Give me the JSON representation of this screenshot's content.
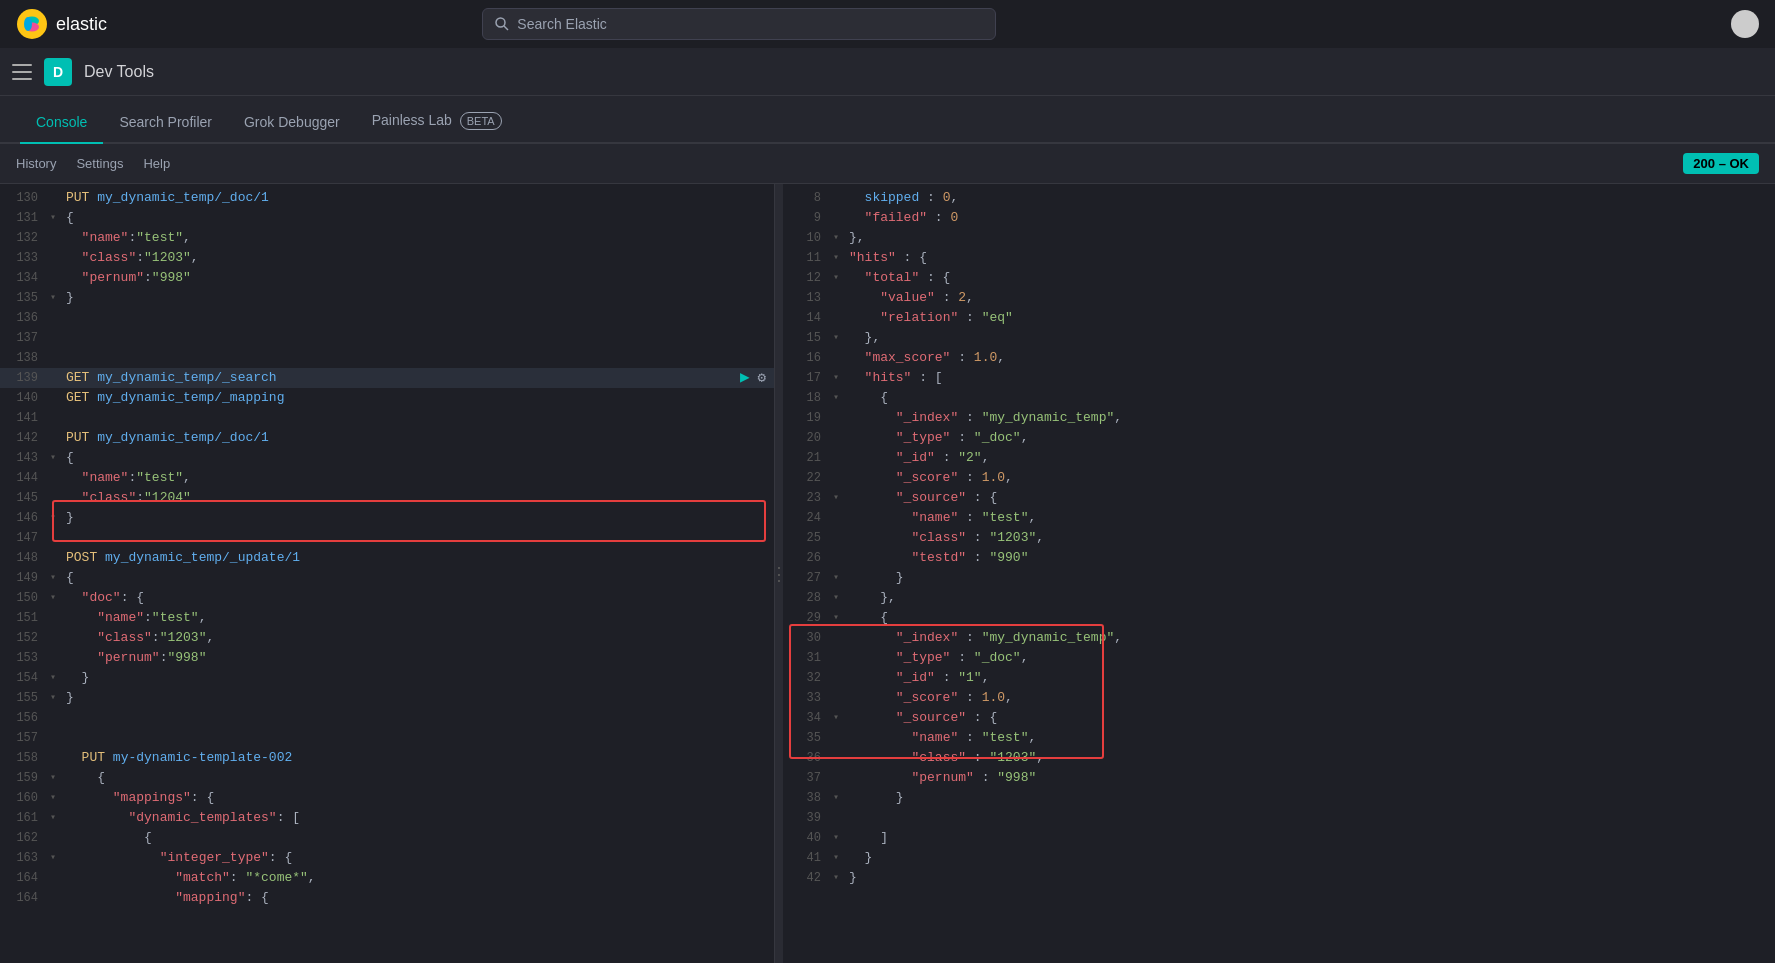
{
  "topbar": {
    "logo_text": "elastic",
    "search_placeholder": "Search Elastic",
    "user_icon": "user-icon"
  },
  "secondbar": {
    "hamburger": "menu-icon",
    "avatar_letter": "D",
    "title": "Dev Tools"
  },
  "tabs": [
    {
      "label": "Console",
      "active": true
    },
    {
      "label": "Search Profiler",
      "active": false
    },
    {
      "label": "Grok Debugger",
      "active": false
    },
    {
      "label": "Painless Lab",
      "active": false,
      "badge": "BETA"
    }
  ],
  "toolbar": {
    "history": "History",
    "settings": "Settings",
    "help": "Help",
    "status": "200 – OK"
  },
  "editor": {
    "lines": [
      {
        "num": "130",
        "arrow": "",
        "content": "PUT my_dynamic_temp/_doc/1",
        "method": "PUT",
        "url": "my_dynamic_temp/_doc/1"
      },
      {
        "num": "131",
        "arrow": "▾",
        "content": "{"
      },
      {
        "num": "132",
        "arrow": "",
        "content": "  \"name\":\"test\","
      },
      {
        "num": "133",
        "arrow": "",
        "content": "  \"class\":\"1203\","
      },
      {
        "num": "134",
        "arrow": "",
        "content": "  \"pernum\":\"998\""
      },
      {
        "num": "135",
        "arrow": "▾",
        "content": "}"
      },
      {
        "num": "136",
        "arrow": "",
        "content": ""
      },
      {
        "num": "137",
        "arrow": "",
        "content": ""
      },
      {
        "num": "138",
        "arrow": "",
        "content": ""
      },
      {
        "num": "139",
        "arrow": "",
        "content": "GET my_dynamic_temp/_search",
        "selected": true
      },
      {
        "num": "140",
        "arrow": "",
        "content": "GET my_dynamic_temp/_mapping"
      },
      {
        "num": "141",
        "arrow": "",
        "content": ""
      },
      {
        "num": "142",
        "arrow": "",
        "content": "PUT my_dynamic_temp/_doc/1"
      },
      {
        "num": "143",
        "arrow": "▾",
        "content": "{"
      },
      {
        "num": "144",
        "arrow": "",
        "content": "  \"name\":\"test\","
      },
      {
        "num": "145",
        "arrow": "",
        "content": "  \"class\":\"1204\""
      },
      {
        "num": "146",
        "arrow": "▾",
        "content": "}"
      },
      {
        "num": "147",
        "arrow": "",
        "content": ""
      },
      {
        "num": "148",
        "arrow": "",
        "content": "POST my_dynamic_temp/_update/1"
      },
      {
        "num": "149",
        "arrow": "▾",
        "content": "{"
      },
      {
        "num": "150",
        "arrow": "▾",
        "content": "  \"doc\": {"
      },
      {
        "num": "151",
        "arrow": "",
        "content": "    \"name\":\"test\","
      },
      {
        "num": "152",
        "arrow": "",
        "content": "    \"class\":\"1203\","
      },
      {
        "num": "153",
        "arrow": "",
        "content": "    \"pernum\":\"998\""
      },
      {
        "num": "154",
        "arrow": "▾",
        "content": "  }"
      },
      {
        "num": "155",
        "arrow": "▾",
        "content": "}"
      },
      {
        "num": "156",
        "arrow": "",
        "content": ""
      },
      {
        "num": "157",
        "arrow": "",
        "content": ""
      },
      {
        "num": "158",
        "arrow": "",
        "content": "  PUT my-dynamic-template-002"
      },
      {
        "num": "159",
        "arrow": "▾",
        "content": "    {"
      },
      {
        "num": "160",
        "arrow": "▾",
        "content": "      \"mappings\": {"
      },
      {
        "num": "161",
        "arrow": "▾",
        "content": "        \"dynamic_templates\": ["
      },
      {
        "num": "162",
        "arrow": "",
        "content": "          {"
      },
      {
        "num": "163",
        "arrow": "▾",
        "content": "            \"integer_type\": {"
      },
      {
        "num": "164",
        "arrow": "",
        "content": "              \"match\": \"*come*\","
      }
    ]
  },
  "result": {
    "lines": [
      {
        "num": "8",
        "arrow": "",
        "content": "  skipped : 0,"
      },
      {
        "num": "9",
        "arrow": "",
        "content": "  \"failed\" : 0"
      },
      {
        "num": "10",
        "arrow": "▾",
        "content": "},"
      },
      {
        "num": "11",
        "arrow": "▾",
        "content": "\"hits\" : {"
      },
      {
        "num": "12",
        "arrow": "▾",
        "content": "  \"total\" : {"
      },
      {
        "num": "13",
        "arrow": "",
        "content": "    \"value\" : 2,"
      },
      {
        "num": "14",
        "arrow": "",
        "content": "    \"relation\" : \"eq\""
      },
      {
        "num": "15",
        "arrow": "▾",
        "content": "  },"
      },
      {
        "num": "16",
        "arrow": "",
        "content": "  \"max_score\" : 1.0,"
      },
      {
        "num": "17",
        "arrow": "▾",
        "content": "  \"hits\" : ["
      },
      {
        "num": "18",
        "arrow": "▾",
        "content": "    {"
      },
      {
        "num": "19",
        "arrow": "",
        "content": "      \"_index\" : \"my_dynamic_temp\","
      },
      {
        "num": "20",
        "arrow": "",
        "content": "      \"_type\" : \"_doc\","
      },
      {
        "num": "21",
        "arrow": "",
        "content": "      \"_id\" : \"2\","
      },
      {
        "num": "22",
        "arrow": "",
        "content": "      \"_score\" : 1.0,"
      },
      {
        "num": "23",
        "arrow": "▾",
        "content": "      \"_source\" : {"
      },
      {
        "num": "24",
        "arrow": "",
        "content": "        \"name\" : \"test\","
      },
      {
        "num": "25",
        "arrow": "",
        "content": "        \"class\" : \"1203\","
      },
      {
        "num": "26",
        "arrow": "",
        "content": "        \"testd\" : \"990\""
      },
      {
        "num": "27",
        "arrow": "▾",
        "content": "      }"
      },
      {
        "num": "28",
        "arrow": "▾",
        "content": "    },"
      },
      {
        "num": "29",
        "arrow": "▾",
        "content": "    {"
      },
      {
        "num": "30",
        "arrow": "",
        "content": "      \"_index\" : \"my_dynamic_temp\","
      },
      {
        "num": "31",
        "arrow": "",
        "content": "      \"_type\" : \"_doc\","
      },
      {
        "num": "32",
        "arrow": "",
        "content": "      \"_id\" : \"1\","
      },
      {
        "num": "33",
        "arrow": "",
        "content": "      \"_score\" : 1.0,"
      },
      {
        "num": "34",
        "arrow": "▾",
        "content": "      \"_source\" : {"
      },
      {
        "num": "35",
        "arrow": "",
        "content": "        \"name\" : \"test\","
      },
      {
        "num": "36",
        "arrow": "",
        "content": "        \"class\" : \"1203\","
      },
      {
        "num": "37",
        "arrow": "",
        "content": "        \"pernum\" : \"998\""
      },
      {
        "num": "38",
        "arrow": "▾",
        "content": "      }"
      },
      {
        "num": "39",
        "arrow": "",
        "content": ""
      },
      {
        "num": "40",
        "arrow": "▾",
        "content": "    ]"
      },
      {
        "num": "41",
        "arrow": "▾",
        "content": "  }"
      },
      {
        "num": "42",
        "arrow": "▾",
        "content": "}"
      }
    ]
  }
}
